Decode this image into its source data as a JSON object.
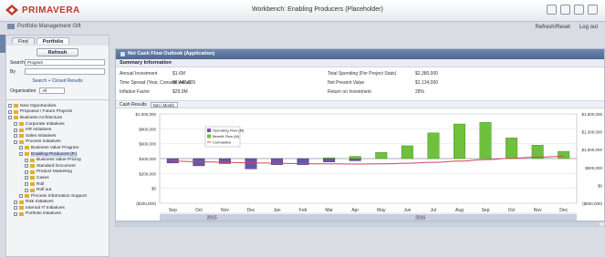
{
  "app": {
    "logo_text": "PRIMAVERA",
    "subtitle": "Portfolio Management Gift",
    "window_title": "Workbench: Enabling Producers (Placeholder)",
    "user_links": [
      "Refresh/Reset",
      "Log out"
    ]
  },
  "left": {
    "tabs": [
      "Find",
      "Portfolio"
    ],
    "search_button": "Refresh",
    "search_label": "Search",
    "search_value": "Program",
    "by_label": "By",
    "advanced_link": "Search + Closed Results",
    "org_label": "Organization",
    "org_value": "All",
    "tree": [
      {
        "label": "New Opportunities",
        "level": 0
      },
      {
        "label": "Proposed / Future Projects",
        "level": 0
      },
      {
        "label": "Business Architecture",
        "level": 0
      },
      {
        "label": "Corporate Initiatives",
        "level": 1
      },
      {
        "label": "HR Initiatives",
        "level": 1
      },
      {
        "label": "Sales Initiatives",
        "level": 1
      },
      {
        "label": "Process Initiatives",
        "level": 1
      },
      {
        "label": "Business Value Program",
        "level": 2
      },
      {
        "label": "Enabling Producers (P.)",
        "level": 2,
        "selected": true
      },
      {
        "label": "Business Value Pricing",
        "level": 3
      },
      {
        "label": "Standard Document",
        "level": 3
      },
      {
        "label": "Product Marketing",
        "level": 3
      },
      {
        "label": "Cases",
        "level": 3
      },
      {
        "label": "Roll",
        "level": 3
      },
      {
        "label": "Roll out",
        "level": 3
      },
      {
        "label": "Process Information Support",
        "level": 2
      },
      {
        "label": "Risk Initiatives",
        "level": 1
      },
      {
        "label": "Internal IT Initiatives",
        "level": 1
      },
      {
        "label": "Portfolio Initiatives",
        "level": 1
      }
    ]
  },
  "main": {
    "header": "Net Cash Flow Outlook (Application)",
    "summary_title": "Summary Information",
    "summary": [
      {
        "k": "Annual Investment",
        "v": "$1.6M"
      },
      {
        "k": "Total Spending (Per Project Stats)",
        "v": "$2,380,000"
      },
      {
        "k": "Time Spread (Year, Consent Value)",
        "v": "$6,447,009"
      },
      {
        "k": "Net Present Value",
        "v": "$1,134,000"
      },
      {
        "k": "Inflation Factor",
        "v": "$29.0M"
      },
      {
        "k": "Return on Investment",
        "v": "28%"
      }
    ],
    "chart_label": "Cash Results",
    "chart_select": "Net / Month"
  },
  "chart_data": {
    "type": "bar",
    "categories": [
      "Sep",
      "Oct",
      "Nov",
      "Dec",
      "Jan",
      "Feb",
      "Mar",
      "Apr",
      "May",
      "Jun",
      "Jul",
      "Aug",
      "Sep",
      "Oct",
      "Nov",
      "Dec"
    ],
    "series": [
      {
        "name": "Operating Flow (M)",
        "color": "#6b56a6",
        "values": [
          -80000,
          -130000,
          -90000,
          -185000,
          -110000,
          -110000,
          -60000,
          -40000,
          0,
          0,
          0,
          0,
          0,
          0,
          0,
          0
        ]
      },
      {
        "name": "Benefit Flow (M)",
        "color": "#6fc13b",
        "values": [
          0,
          0,
          0,
          0,
          0,
          0,
          15000,
          40000,
          110000,
          230000,
          460000,
          620000,
          650000,
          370000,
          240000,
          130000
        ]
      },
      {
        "name": "Cumulative",
        "color": "#cc4a5a",
        "values": [
          -380000,
          -470000,
          -560000,
          -640000,
          -700000,
          -760000,
          -790000,
          -810000,
          -780000,
          -700000,
          -560000,
          -380000,
          -160000,
          40000,
          220000,
          340000
        ]
      }
    ],
    "ylim": [
      -800000,
      800000
    ],
    "left_ticks": [
      "$1,000,000",
      "$800,000",
      "$600,000",
      "$400,000",
      "$200,000",
      "$0",
      "($200,000)"
    ],
    "right_ticks": [
      "$1,600,000",
      "$1,300,000",
      "$1,000,000",
      "$500,000",
      "$0",
      "($600,000)"
    ],
    "year_labels": [
      "2015",
      "2016"
    ]
  }
}
